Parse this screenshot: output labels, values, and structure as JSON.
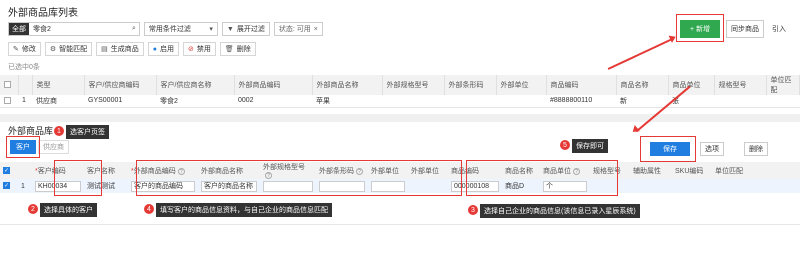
{
  "top": {
    "title": "外部商品库列表",
    "all_tag": "全部",
    "search_value": "零食2",
    "filter_select": "常用条件过滤",
    "expand_label": "展开过滤",
    "status_label": "状态: 可用",
    "status_close": "×",
    "new_button": "+ 新增",
    "sync_button": "同步商品",
    "import_button": "引入",
    "toolbar": [
      "修改",
      "智能匹配",
      "生成商品",
      "启用",
      "禁用",
      "删除"
    ],
    "selected_count": "已选中0条",
    "columns": [
      "类型",
      "客户/供应商编码",
      "客户/供应商名称",
      "外部商品编码",
      "外部商品名称",
      "外部规格型号",
      "外部条形码",
      "外部单位",
      "商品编码",
      "商品名称",
      "商品单位",
      "规格型号",
      "单位匹配"
    ],
    "rows": [
      {
        "index": "1",
        "cells": [
          "供应商",
          "GYS00001",
          "零食2",
          "0002",
          "苹果",
          "",
          "",
          "",
          "#8888800110",
          "新",
          "张",
          "",
          ""
        ]
      }
    ]
  },
  "bottom": {
    "title": "外部商品库",
    "tab_customer": "客户",
    "tab_supplier": "供应商",
    "save_button": "保存",
    "options_button": "选项",
    "delete_button": "删除",
    "columns": [
      "客户编码",
      "客户名称",
      "外部商品编码",
      "外部商品名称",
      "外部规格型号",
      "外部条形码",
      "外部单位",
      "外部单位",
      "商品编码",
      "商品名称",
      "商品单位",
      "规格型号",
      "辅助属性",
      "SKU编码",
      "单位匹配"
    ],
    "row": {
      "index": "1",
      "customer_code": "KH00034",
      "customer_name": "测试测试",
      "ext_code": "客户的商品编码",
      "ext_name": "客户的商品名称",
      "ext_spec": "",
      "ext_barcode": "",
      "ext_unit": "",
      "ext_unit2": "",
      "goods_code": "000000108",
      "goods_name": "商品D",
      "goods_unit": "个"
    }
  },
  "annotations": {
    "n1": "1",
    "t1": "选客户页签",
    "n2": "2",
    "t2": "选择具体的客户",
    "n3": "3",
    "t3": "选择自己企业的商品信息(该信息已录入星辰系统)",
    "n4": "4",
    "t4": "填写客户的商品信息资料，与自己企业的商品信息匹配",
    "n5": "5",
    "t5": "保存即可"
  }
}
